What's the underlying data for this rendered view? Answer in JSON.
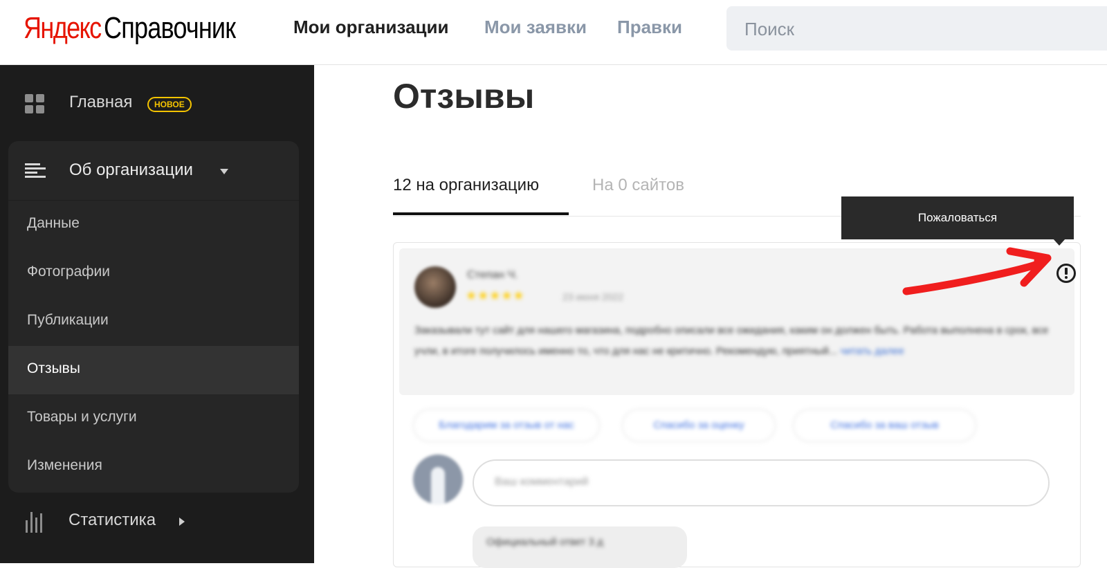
{
  "header": {
    "logo_brand": "Яндекс",
    "logo_product": "Справочник",
    "nav": [
      "Мои организации",
      "Мои заявки",
      "Правки"
    ],
    "search_placeholder": "Поиск"
  },
  "sidebar": {
    "home": {
      "label": "Главная",
      "badge": "НОВОЕ",
      "icon": "grid-icon"
    },
    "org": {
      "label": "Об организации",
      "icon": "lines-icon",
      "items": [
        {
          "label": "Данные",
          "active": false
        },
        {
          "label": "Фотографии",
          "active": false
        },
        {
          "label": "Публикации",
          "active": false
        },
        {
          "label": "Отзывы",
          "active": true
        },
        {
          "label": "Товары и услуги",
          "active": false
        },
        {
          "label": "Изменения",
          "active": false
        }
      ]
    },
    "stats": {
      "label": "Статистика",
      "icon": "bar-chart-icon"
    }
  },
  "main": {
    "title": "Отзывы",
    "tabs": [
      {
        "label": "12 на организацию",
        "active": true
      },
      {
        "label": "На 0 сайтов",
        "active": false
      }
    ],
    "review": {
      "author": "Степан Ч.",
      "stars": "★★★★★",
      "date": "23 июня 2022",
      "text": "Заказывали тут сайт для нашего магазина, подробно описали все ожидания, каким он должен быть. Работа выполнена в срок, все учли, в итоге получилось именно то, что для нас не критично. Рекомендую, приятный...",
      "more": "читать далее"
    },
    "quick_replies": [
      "Благодарим за отзыв от нас",
      "Спасибо за оценку",
      "Спасибо за ваш отзыв"
    ],
    "comment_placeholder": "Ваш комментарий",
    "official_reply": "Официальный ответ  3 д",
    "tooltip": "Пожаловаться"
  },
  "colors": {
    "brand_red": "#e61400",
    "badge_yellow": "#f5c400",
    "sidebar_bg": "#1c1c1c",
    "annotation_red": "#f01e1e"
  }
}
